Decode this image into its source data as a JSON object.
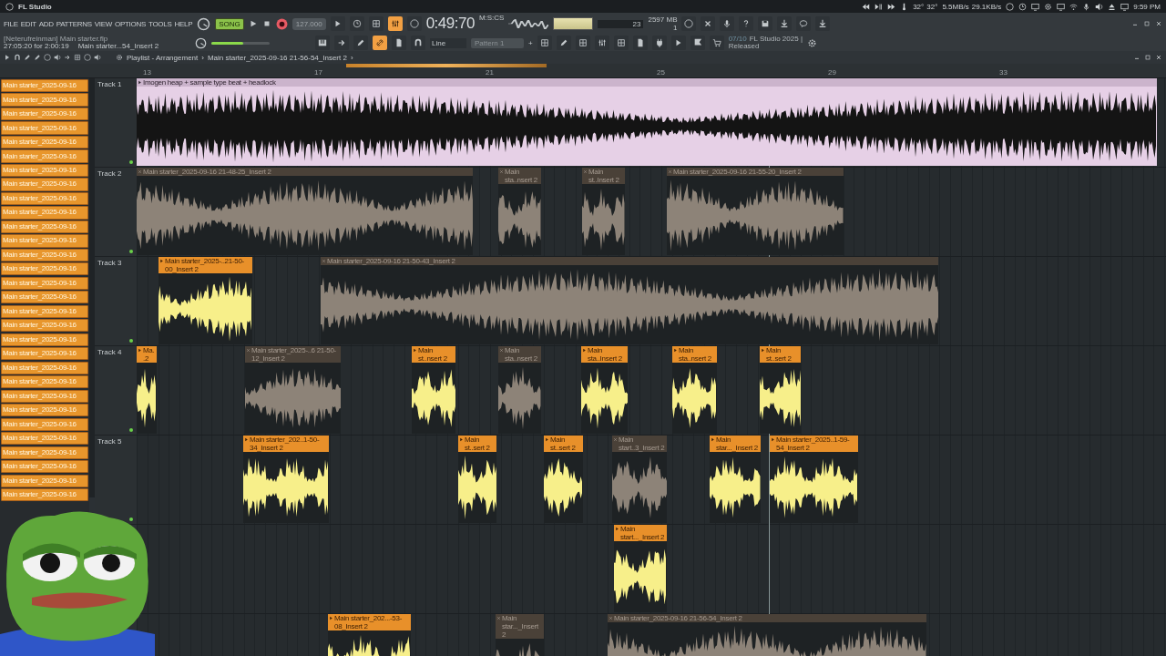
{
  "window": {
    "title": "FL Studio"
  },
  "tray": {
    "temps": [
      "32°",
      "32°"
    ],
    "net": [
      "5.5MB/s",
      "29.1KB/s"
    ],
    "time": "9:59 PM"
  },
  "menu": [
    "FILE",
    "EDIT",
    "ADD",
    "PATTERNS",
    "VIEW",
    "OPTIONS",
    "TOOLS",
    "HELP"
  ],
  "transport": {
    "mode": "SONG",
    "song_on": true,
    "tempo": "127.000",
    "time": "0:49:70",
    "time_unit": "M:S:CS"
  },
  "project": {
    "file": "[Neterufreinman] Main starter.flp",
    "duration": "27:05:20 for 2:00:19",
    "hint": "Main starter...54_Insert 2"
  },
  "master_volume": {
    "level": 0.55
  },
  "cpu": {
    "value": "23",
    "memory": "2597 MB",
    "polyphony": "1"
  },
  "snap": "Line",
  "pattern": "Pattern 1",
  "pattern_add": "+",
  "news": {
    "date": "07/10",
    "text": "FL Studio 2025 |",
    "text_2": "Released"
  },
  "playlist": {
    "title": "Playlist - Arrangement",
    "separator": "›",
    "clip": "Main starter_2025-09-16 21-56-54_Insert 2",
    "separator_2": "›",
    "ruler": [
      "13",
      "17",
      "21",
      "25",
      "29",
      "33"
    ],
    "patterns": [
      "Main starter_2025-09-16",
      "Main starter_2025-09-16",
      "Main starter_2025-09-16",
      "Main starter_2025-09-16",
      "Main starter_2025-09-16",
      "Main starter_2025-09-16",
      "Main starter_2025-09-16",
      "Main starter_2025-09-16",
      "Main starter_2025-09-16",
      "Main starter_2025-09-16",
      "Main starter_2025-09-16",
      "Main starter_2025-09-16",
      "Main starter_2025-09-16",
      "Main starter_2025-09-16",
      "Main starter_2025-09-16",
      "Main starter_2025-09-16",
      "Main starter_2025-09-16",
      "Main starter_2025-09-16",
      "Main starter_2025-09-16",
      "Main starter_2025-09-16",
      "Main starter_2025-09-16",
      "Main starter_2025-09-16",
      "Main starter_2025-09-16",
      "Main starter_2025-09-16",
      "Main starter_2025-09-16",
      "Main starter_2025-09-16",
      "Main starter_2025-09-16",
      "Main starter_2025-09-16",
      "Main starter_2025-09-16",
      "Main starter_2025-09-16"
    ],
    "tracks": [
      {
        "name": "Track 1",
        "clips": [
          {
            "label": "Imogen heap + sample type beat + headlock",
            "kind": "inverted",
            "muted": false,
            "color": "#cbb4cc"
          }
        ]
      },
      {
        "name": "Track 2",
        "clips": [
          {
            "label": "Main starter_2025-09-16 21-48-25_Insert 2",
            "kind": "audio",
            "muted": true,
            "color": "#4a4138"
          },
          {
            "label": "Main sta..nsert 2",
            "kind": "audio",
            "muted": true,
            "color": "#4a4138"
          },
          {
            "label": "Main st..Insert 2",
            "kind": "audio",
            "muted": true,
            "color": "#4a4138"
          },
          {
            "label": "Main starter_2025-09-16 21-55-20_Insert 2",
            "kind": "audio",
            "muted": true,
            "color": "#4a4138"
          }
        ]
      },
      {
        "name": "Track 3",
        "clips": [
          {
            "label": "Main starter_2025-..21-50-00_Insert 2",
            "kind": "audio",
            "muted": false,
            "color": "#e8902a"
          },
          {
            "label": "Main starter_2025-09-16 21-50-43_Insert 2",
            "kind": "audio",
            "muted": true,
            "color": "#4a4138"
          }
        ]
      },
      {
        "name": "Track 4",
        "clips": [
          {
            "label": "Ma..2",
            "kind": "audio",
            "muted": false,
            "color": "#e8902a"
          },
          {
            "label": "Main starter_2025-..6 21-50-12_Insert 2",
            "kind": "audio",
            "muted": true,
            "color": "#4a4138"
          },
          {
            "label": "Main st..nsert 2",
            "kind": "audio",
            "muted": false,
            "color": "#e8902a"
          },
          {
            "label": "Main sta..nsert 2",
            "kind": "audio",
            "muted": true,
            "color": "#4a4138"
          },
          {
            "label": "Main sta..Insert 2",
            "kind": "audio",
            "muted": false,
            "color": "#e8902a"
          },
          {
            "label": "Main sta..nsert 2",
            "kind": "audio",
            "muted": false,
            "color": "#e8902a"
          },
          {
            "label": "Main st..sert 2",
            "kind": "audio",
            "muted": false,
            "color": "#e8902a"
          }
        ]
      },
      {
        "name": "Track 5",
        "clips": [
          {
            "label": "Main starter_202..1-50-34_Insert 2",
            "kind": "audio",
            "muted": false,
            "color": "#e8902a"
          },
          {
            "label": "Main st..sert 2",
            "kind": "audio",
            "muted": false,
            "color": "#e8902a"
          },
          {
            "label": "Main st..sert 2",
            "kind": "audio",
            "muted": false,
            "color": "#e8902a"
          },
          {
            "label": "Main start..3_Insert 2",
            "kind": "audio",
            "muted": true,
            "color": "#4a4138"
          },
          {
            "label": "Main star..._Insert 2",
            "kind": "audio",
            "muted": false,
            "color": "#e8902a"
          },
          {
            "label": "Main starter_2025..1-59-54_Insert 2",
            "kind": "audio",
            "muted": false,
            "color": "#e8902a"
          }
        ]
      },
      {
        "clips": [
          {
            "label": "Main start..._Insert 2",
            "kind": "audio",
            "muted": false,
            "color": "#e8902a"
          }
        ]
      },
      {
        "clips": [
          {
            "label": "Main starter_202...-53-08_Insert 2",
            "kind": "audio",
            "muted": false,
            "color": "#e8902a"
          },
          {
            "label": "Main star..._Insert 2",
            "kind": "audio",
            "muted": true,
            "color": "#4a4138"
          },
          {
            "label": "Main starter_2025-09-16 21-56-54_Insert 2",
            "kind": "audio",
            "muted": true,
            "color": "#4a4138"
          }
        ]
      }
    ]
  }
}
